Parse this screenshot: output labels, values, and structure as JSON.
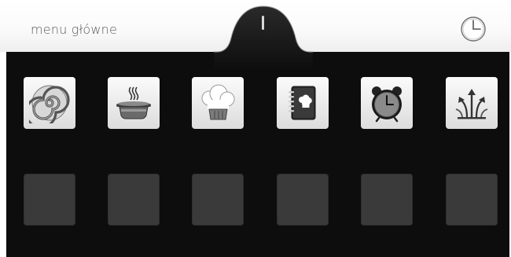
{
  "header": {
    "title": "menu główne",
    "clock_button": "clock-icon"
  },
  "apps": [
    {
      "name": "spiral-program-icon"
    },
    {
      "name": "steaming-pot-icon"
    },
    {
      "name": "chef-hat-icon"
    },
    {
      "name": "recipe-book-icon"
    },
    {
      "name": "alarm-clock-icon"
    },
    {
      "name": "steam-arrows-icon"
    }
  ],
  "empty_slots": 6,
  "colors": {
    "panel": "#0d0d0d",
    "empty_tile": "#3a3a3a",
    "title_text": "#5a5a5a"
  }
}
